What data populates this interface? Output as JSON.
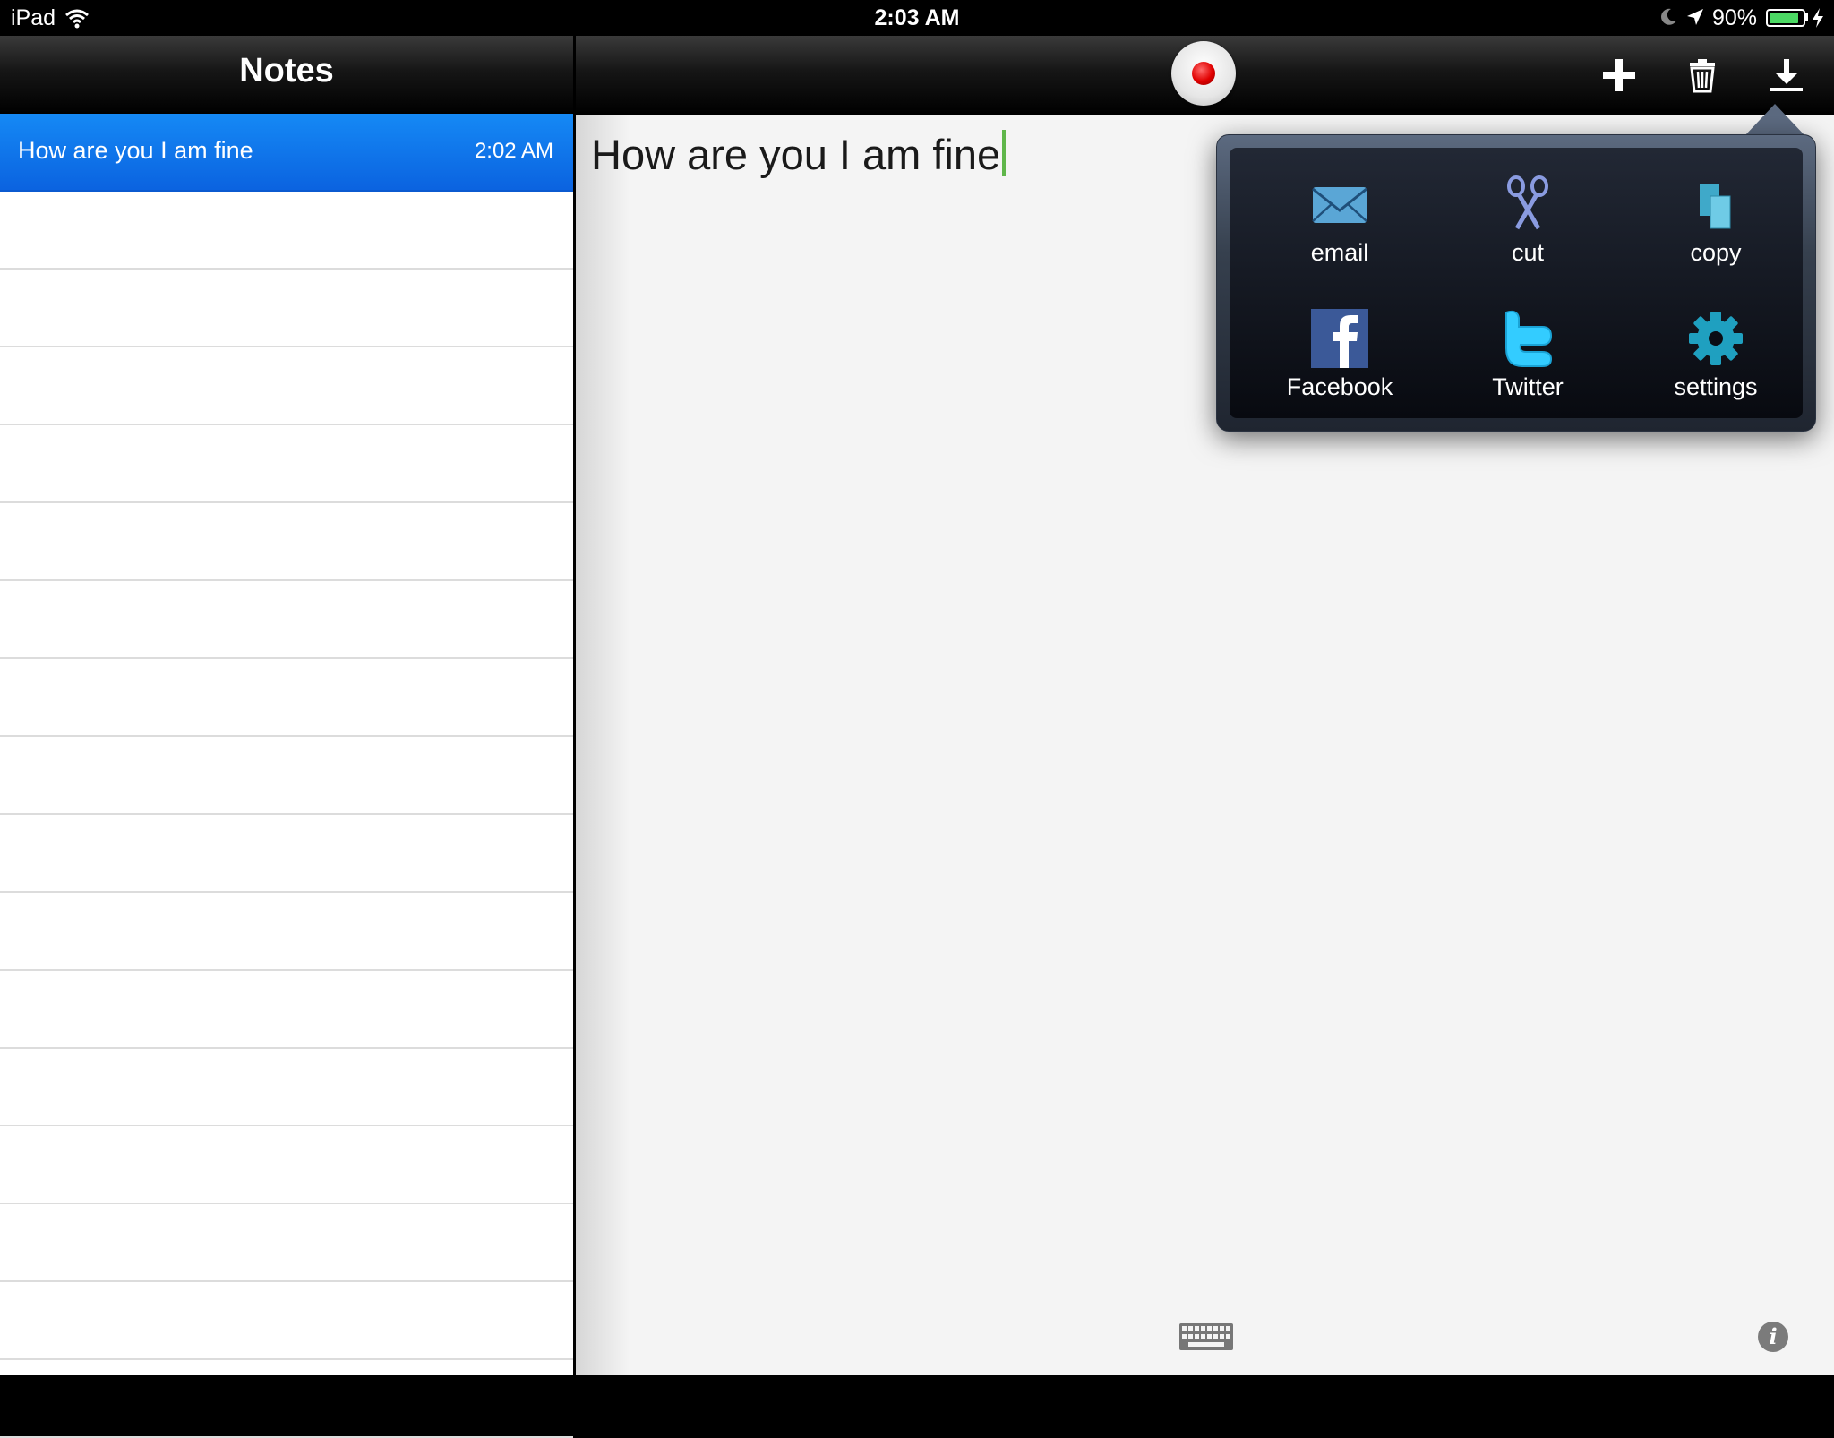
{
  "status_bar": {
    "device": "iPad",
    "time": "2:03 AM",
    "battery_percent": "90%",
    "battery_level": 0.9
  },
  "left_pane": {
    "title": "Notes",
    "notes": [
      {
        "text": "How are you I am fine",
        "time": "2:02 AM",
        "selected": true
      }
    ]
  },
  "toolbar": {
    "record": "record-icon",
    "add": "plus-icon",
    "delete": "trash-icon",
    "export": "download-icon"
  },
  "editor": {
    "text": "How are you I am fine"
  },
  "share_menu": {
    "items": [
      {
        "label": "email",
        "icon": "envelope-icon"
      },
      {
        "label": "cut",
        "icon": "scissors-icon"
      },
      {
        "label": "copy",
        "icon": "copy-icon"
      },
      {
        "label": "Facebook",
        "icon": "facebook-icon"
      },
      {
        "label": "Twitter",
        "icon": "twitter-icon"
      },
      {
        "label": "settings",
        "icon": "gear-icon"
      }
    ]
  },
  "colors": {
    "selection": "#0b63e0",
    "caret": "#5fb64a",
    "record": "#e00000"
  }
}
